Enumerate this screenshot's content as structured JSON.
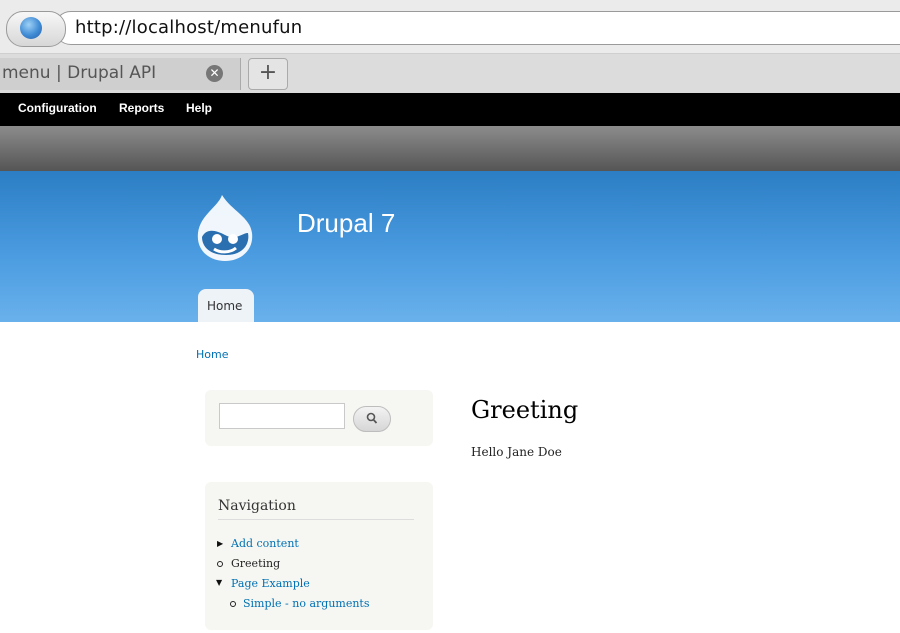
{
  "browser": {
    "url": "http://localhost/menufun",
    "tab_title": "menu | Drupal API",
    "close_glyph": "✕",
    "new_tab_glyph": "+"
  },
  "admin_toolbar": {
    "items": [
      "Configuration",
      "Reports",
      "Help"
    ]
  },
  "header": {
    "site_name": "Drupal 7",
    "primary_tab": "Home"
  },
  "breadcrumb": "Home",
  "search": {
    "value": "",
    "icon": "search-icon"
  },
  "navigation": {
    "title": "Navigation",
    "items": [
      {
        "label": "Add content",
        "marker": "collapsed-triangle",
        "link": true
      },
      {
        "label": "Greeting",
        "marker": "bullet",
        "link": false
      },
      {
        "label": "Page Example",
        "marker": "expanded-triangle",
        "link": true
      },
      {
        "label": "Simple - no arguments",
        "marker": "bullet",
        "link": true
      }
    ]
  },
  "main": {
    "title": "Greeting",
    "body": "Hello Jane Doe"
  },
  "colors": {
    "header_top": "#2c7ec4",
    "header_bottom": "#69b1ec",
    "link": "#0071b3",
    "admin_bar": "#000000"
  }
}
